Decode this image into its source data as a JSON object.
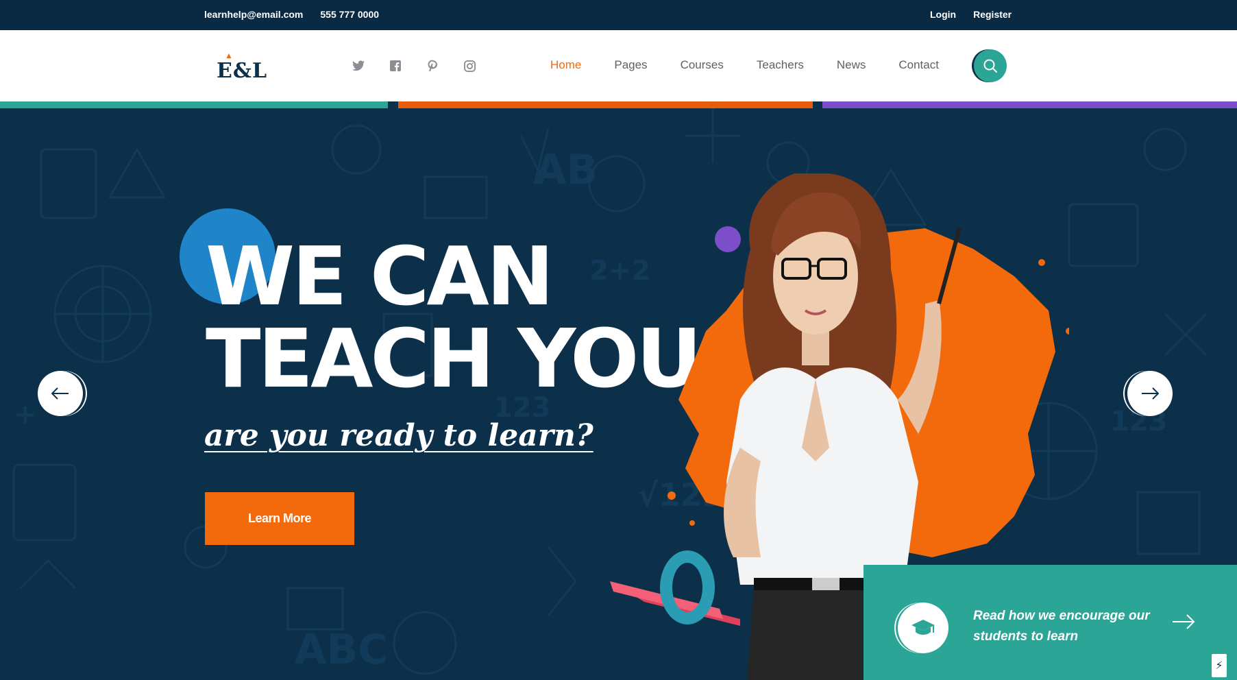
{
  "topbar": {
    "email": "learnhelp@email.com",
    "phone": "555 777 0000",
    "login": "Login",
    "register": "Register"
  },
  "header": {
    "logo_text": "E&L",
    "socials": [
      "twitter-icon",
      "facebook-icon",
      "pinterest-icon",
      "instagram-icon"
    ],
    "nav": [
      "Home",
      "Pages",
      "Courses",
      "Teachers",
      "News",
      "Contact"
    ],
    "active_nav": "Home",
    "search_icon": "search-icon"
  },
  "colors": {
    "navy": "#0c2f4a",
    "orange": "#f26a0c",
    "teal": "#2ba596",
    "purple": "#7d4ec9",
    "blue": "#1f85c8"
  },
  "hero": {
    "headline_line1": "WE CAN",
    "headline_line2": "TEACH YOU",
    "tagline": "are you ready to learn?",
    "cta": "Learn More",
    "prev_icon": "arrow-left-icon",
    "next_icon": "arrow-right-icon"
  },
  "promo": {
    "text": "Read how we encourage our students to learn",
    "icon": "graduation-cap-icon",
    "arrow_icon": "arrow-right-icon"
  }
}
